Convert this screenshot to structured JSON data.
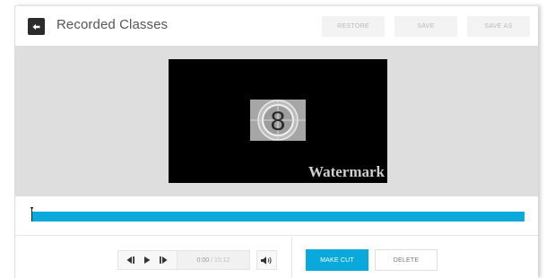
{
  "header": {
    "title": "Recorded Classes",
    "back_icon": "arrow-left-icon",
    "buttons": {
      "restore": "RESTORE",
      "save": "SAVE",
      "save_as": "SAVE AS"
    }
  },
  "preview": {
    "countdown_number": "8",
    "watermark": "Watermark"
  },
  "timeline": {
    "color": "#0aa9dc"
  },
  "controls": {
    "current_time": "0:00",
    "separator": " / ",
    "total_time": "15:12",
    "icons": [
      "step-back-icon",
      "play-icon",
      "step-forward-icon",
      "volume-icon"
    ],
    "make_cut": "MAKE CUT",
    "delete": "DELETE"
  },
  "colors": {
    "accent": "#0aa9dc",
    "preview_bg": "#dedede"
  }
}
